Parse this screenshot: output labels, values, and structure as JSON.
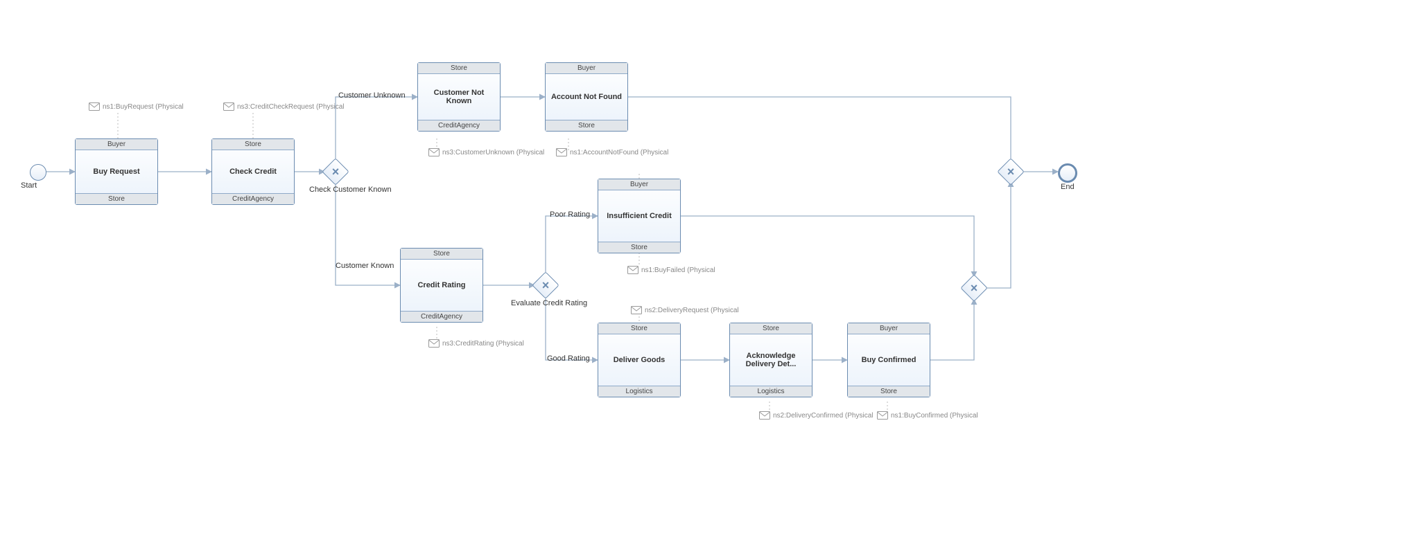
{
  "events": {
    "start": "Start",
    "end": "End"
  },
  "gateways": {
    "check_customer": "Check Customer Known",
    "evaluate_rating": "Evaluate Credit Rating"
  },
  "branches": {
    "customer_unknown": "Customer Unknown",
    "customer_known": "Customer Known",
    "poor_rating": "Poor Rating",
    "good_rating": "Good Rating"
  },
  "tasks": {
    "buy_request": {
      "from": "Buyer",
      "title": "Buy Request",
      "to": "Store"
    },
    "check_credit": {
      "from": "Store",
      "title": "Check Credit",
      "to": "CreditAgency"
    },
    "cust_not_known": {
      "from": "Store",
      "title": "Customer Not Known",
      "to": "CreditAgency"
    },
    "acct_not_found": {
      "from": "Buyer",
      "title": "Account Not Found",
      "to": "Store"
    },
    "credit_rating": {
      "from": "Store",
      "title": "Credit Rating",
      "to": "CreditAgency"
    },
    "insuff_credit": {
      "from": "Buyer",
      "title": "Insufficient Credit",
      "to": "Store"
    },
    "deliver_goods": {
      "from": "Store",
      "title": "Deliver Goods",
      "to": "Logistics"
    },
    "ack_deliv": {
      "from": "Store",
      "title": "Acknowledge Delivery Det...",
      "to": "Logistics"
    },
    "buy_confirmed": {
      "from": "Buyer",
      "title": "Buy Confirmed",
      "to": "Store"
    }
  },
  "messages": {
    "buy_request": "ns1:BuyRequest (Physical",
    "check_credit": "ns3:CreditCheckRequest (Physical",
    "cust_unknown": "ns3:CustomerUnknown (Physical",
    "acct_notfound": "ns1:AccountNotFound (Physical",
    "credit_rating": "ns3:CreditRating (Physical",
    "buy_failed": "ns1:BuyFailed (Physical",
    "deliv_req": "ns2:DeliveryRequest (Physical",
    "deliv_conf": "ns2:DeliveryConfirmed (Physical",
    "buy_conf": "ns1:BuyConfirmed (Physical"
  }
}
